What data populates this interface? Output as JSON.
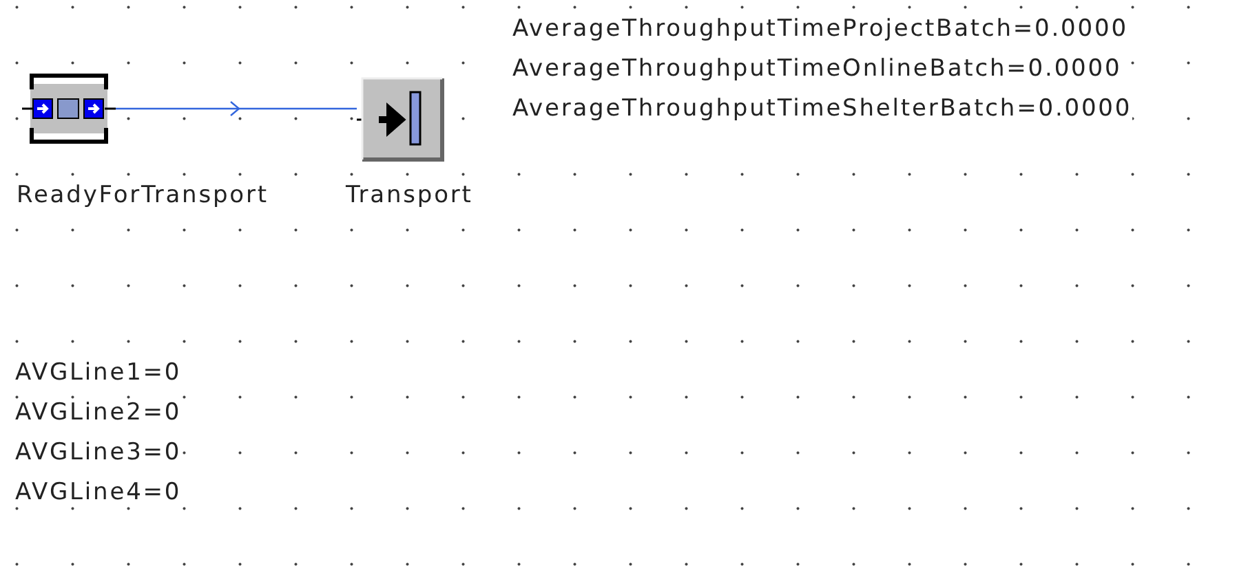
{
  "objects": [
    {
      "kind": "buffer",
      "label": "ReadyForTransport"
    },
    {
      "kind": "drain",
      "label": "Transport"
    }
  ],
  "connector": {
    "connected": true
  },
  "comments_top": [
    "AverageThroughputTimeProjectBatch=0.0000",
    "AverageThroughputTimeOnlineBatch=0.0000",
    "AverageThroughputTimeShelterBatch=0.0000"
  ],
  "comments_bottom": [
    "AVGLine1=0",
    "AVGLine2=0",
    "AVGLine3=0",
    "AVGLine4=0"
  ]
}
